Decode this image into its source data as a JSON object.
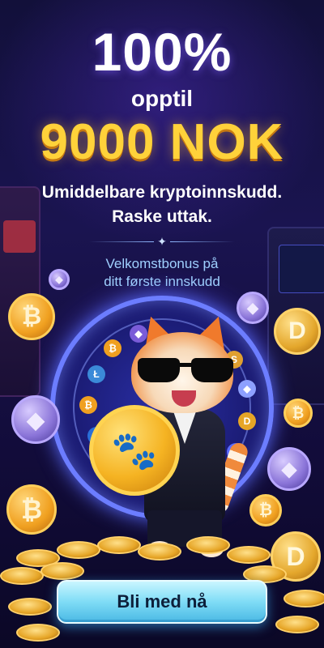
{
  "headline": {
    "percent": "100%",
    "upto": "opptil",
    "amount": "9000 NOK",
    "line1": "Umiddelbare kryptoinnskudd.",
    "line2": "Raske uttak."
  },
  "welcome": {
    "line1": "Velkomstbonus på",
    "line2": "ditt første innskudd"
  },
  "cta": {
    "label": "Bli med nå"
  },
  "coins": {
    "btc_symbol": "₿",
    "eth_symbol": "◆",
    "doge_symbol": "D",
    "paw_symbol": "🐾"
  },
  "colors": {
    "accent_gold": "#ffd23a",
    "cta_blue": "#7fdcf6",
    "welcome_text": "#9fd0ff"
  }
}
